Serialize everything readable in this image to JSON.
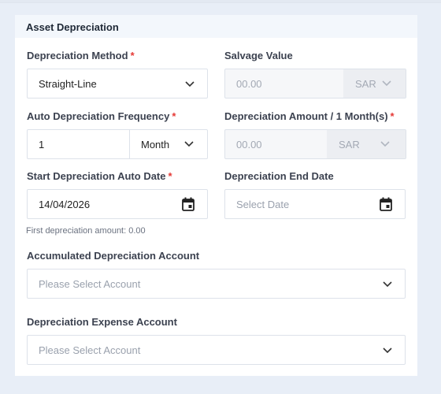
{
  "card": {
    "title": "Asset Depreciation"
  },
  "method": {
    "label": "Depreciation Method",
    "required_mark": "*",
    "value": "Straight-Line"
  },
  "salvage": {
    "label": "Salvage Value",
    "placeholder": "00.00",
    "currency": "SAR"
  },
  "frequency": {
    "label": "Auto Depreciation Frequency",
    "required_mark": "*",
    "value": "1",
    "unit": "Month"
  },
  "amount": {
    "label": "Depreciation Amount / 1 Month(s)",
    "required_mark": "*",
    "placeholder": "00.00",
    "currency": "SAR"
  },
  "start_date": {
    "label": "Start Depreciation Auto Date",
    "required_mark": "*",
    "value": "14/04/2026",
    "hint": "First depreciation amount: 0.00"
  },
  "end_date": {
    "label": "Depreciation End Date",
    "placeholder": "Select Date"
  },
  "accumulated_account": {
    "label": "Accumulated Depreciation Account",
    "placeholder": "Please Select Account"
  },
  "expense_account": {
    "label": "Depreciation Expense Account",
    "placeholder": "Please Select Account"
  },
  "icons": {
    "chevron": "chevron-down-icon",
    "calendar": "calendar-icon"
  },
  "colors": {
    "required": "#e53935",
    "background": "#e8eef7",
    "header": "#f3f7fc"
  }
}
